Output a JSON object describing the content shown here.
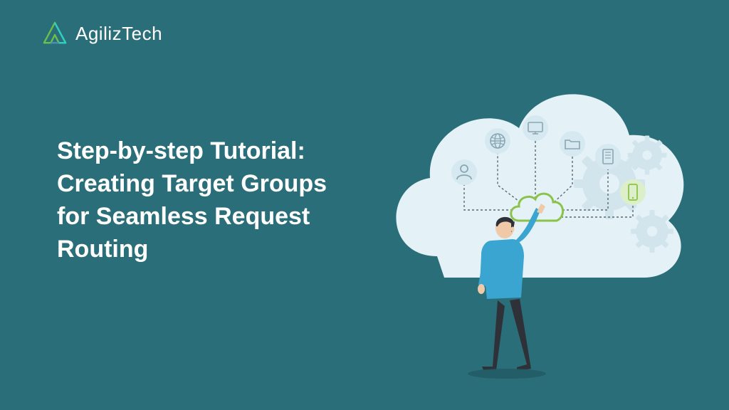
{
  "brand": {
    "name": "AgilizTech"
  },
  "hero": {
    "title": "Step-by-step Tutorial: Creating Target Groups for Seamless Request Routing"
  },
  "colors": {
    "background": "#2a6e7a",
    "cloud": "#e4f2f8",
    "accent_green": "#8bc34a",
    "gears": "#d9eaf1",
    "icon_bg": "#d3e8f0",
    "icon_stroke": "#9ab5c0",
    "shirt": "#3aa5d1",
    "pants": "#2e3238",
    "skin": "#f0c9a8",
    "hair": "#2e3238"
  }
}
